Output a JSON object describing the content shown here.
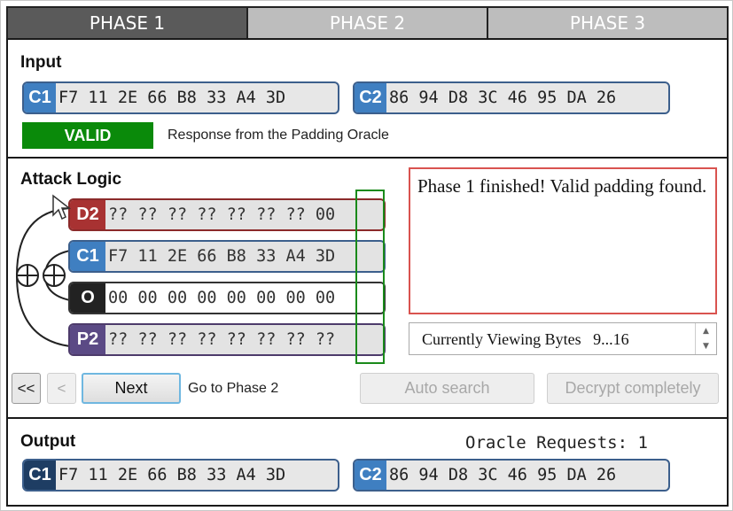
{
  "tabs": [
    {
      "label": "PHASE 1",
      "active": true
    },
    {
      "label": "PHASE 2",
      "active": false
    },
    {
      "label": "PHASE 3",
      "active": false
    }
  ],
  "input": {
    "title": "Input",
    "c1": {
      "label": "C1",
      "bytes": "F7 11 2E 66 B8 33 A4 3D"
    },
    "c2": {
      "label": "C2",
      "bytes": "86 94 D8 3C 46 95 DA 26"
    },
    "status": "VALID",
    "status_note": "Response from the Padding Oracle"
  },
  "attack": {
    "title": "Attack Logic",
    "rows": [
      {
        "label": "D2",
        "bytes": "?? ?? ?? ?? ?? ?? ?? 00"
      },
      {
        "label": "C1",
        "bytes": "F7 11 2E 66 B8 33 A4 3D"
      },
      {
        "label": "O",
        "bytes": "00 00 00 00 00 00 00 00"
      },
      {
        "label": "P2",
        "bytes": "?? ?? ?? ?? ?? ?? ?? ??"
      }
    ],
    "message": "Phase 1 finished! Valid padding found.",
    "viewing": {
      "label": "Currently Viewing Bytes",
      "value": "9...16"
    },
    "buttons": {
      "first": "<<",
      "prev": "<",
      "next": "Next",
      "goto_note": "Go to Phase 2",
      "auto_search": "Auto search",
      "decrypt": "Decrypt completely"
    }
  },
  "output": {
    "title": "Output",
    "oracle_label": "Oracle Requests:",
    "oracle_count": "1",
    "c1": {
      "label": "C1",
      "bytes": "F7 11 2E 66 B8 33 A4 3D"
    },
    "c2": {
      "label": "C2",
      "bytes": "86 94 D8 3C 46 95 DA 26"
    }
  },
  "colors": {
    "valid": "#0a8a0a",
    "message_border": "#d9534f",
    "highlight": "#1a8a1a"
  }
}
